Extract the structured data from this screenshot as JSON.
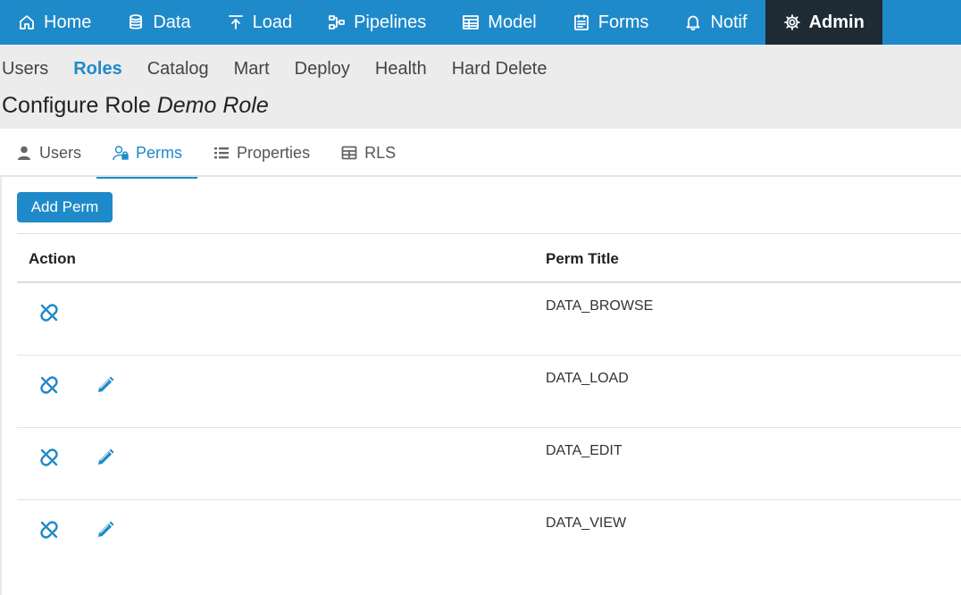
{
  "topnav": {
    "items": [
      {
        "label": "Home",
        "icon": "home-icon"
      },
      {
        "label": "Data",
        "icon": "database-icon"
      },
      {
        "label": "Load",
        "icon": "upload-icon"
      },
      {
        "label": "Pipelines",
        "icon": "pipelines-icon"
      },
      {
        "label": "Model",
        "icon": "model-icon"
      },
      {
        "label": "Forms",
        "icon": "forms-icon"
      },
      {
        "label": "Notif",
        "icon": "bell-icon"
      },
      {
        "label": "Admin",
        "icon": "gear-icon",
        "active": true
      }
    ]
  },
  "subnav": {
    "items": [
      {
        "label": "Users"
      },
      {
        "label": "Roles",
        "active": true
      },
      {
        "label": "Catalog"
      },
      {
        "label": "Mart"
      },
      {
        "label": "Deploy"
      },
      {
        "label": "Health"
      },
      {
        "label": "Hard Delete"
      }
    ]
  },
  "page": {
    "title_prefix": "Configure Role",
    "title_role": "Demo Role"
  },
  "tabs": [
    {
      "label": "Users",
      "icon": "user-icon"
    },
    {
      "label": "Perms",
      "icon": "user-lock-icon",
      "active": true
    },
    {
      "label": "Properties",
      "icon": "list-icon"
    },
    {
      "label": "RLS",
      "icon": "table-icon"
    }
  ],
  "toolbar": {
    "add_label": "Add Perm"
  },
  "table": {
    "headers": {
      "action": "Action",
      "perm_title": "Perm Title"
    },
    "rows": [
      {
        "title": "DATA_BROWSE",
        "editable": false
      },
      {
        "title": "DATA_LOAD",
        "editable": true
      },
      {
        "title": "DATA_EDIT",
        "editable": true
      },
      {
        "title": "DATA_VIEW",
        "editable": true
      }
    ]
  },
  "colors": {
    "primary": "#1f8ac9",
    "admin_bg": "#1e2b35",
    "subnav_bg": "#ececec"
  }
}
